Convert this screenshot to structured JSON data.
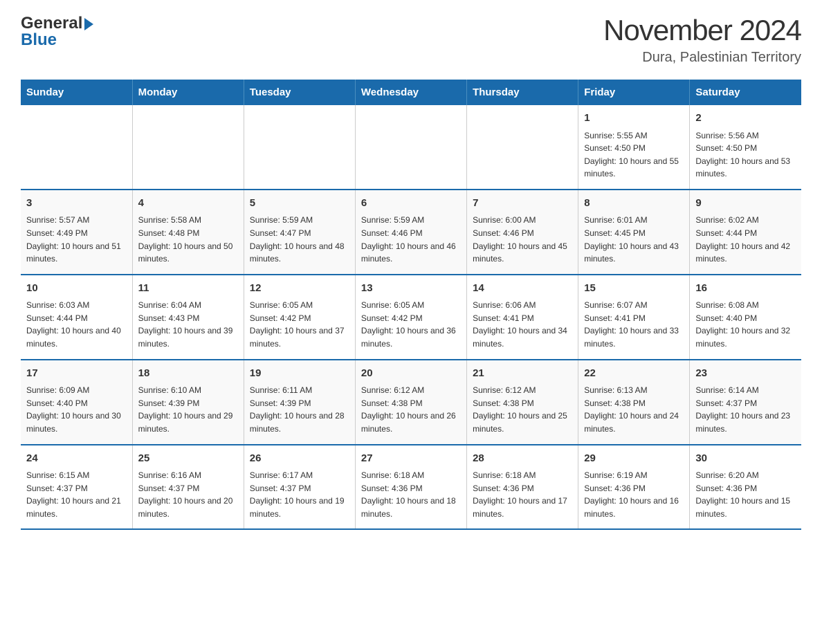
{
  "logo": {
    "general": "General",
    "blue": "Blue",
    "arrow": "▶"
  },
  "title": "November 2024",
  "subtitle": "Dura, Palestinian Territory",
  "days_of_week": [
    "Sunday",
    "Monday",
    "Tuesday",
    "Wednesday",
    "Thursday",
    "Friday",
    "Saturday"
  ],
  "weeks": [
    [
      {
        "day": "",
        "info": ""
      },
      {
        "day": "",
        "info": ""
      },
      {
        "day": "",
        "info": ""
      },
      {
        "day": "",
        "info": ""
      },
      {
        "day": "",
        "info": ""
      },
      {
        "day": "1",
        "info": "Sunrise: 5:55 AM\nSunset: 4:50 PM\nDaylight: 10 hours and 55 minutes."
      },
      {
        "day": "2",
        "info": "Sunrise: 5:56 AM\nSunset: 4:50 PM\nDaylight: 10 hours and 53 minutes."
      }
    ],
    [
      {
        "day": "3",
        "info": "Sunrise: 5:57 AM\nSunset: 4:49 PM\nDaylight: 10 hours and 51 minutes."
      },
      {
        "day": "4",
        "info": "Sunrise: 5:58 AM\nSunset: 4:48 PM\nDaylight: 10 hours and 50 minutes."
      },
      {
        "day": "5",
        "info": "Sunrise: 5:59 AM\nSunset: 4:47 PM\nDaylight: 10 hours and 48 minutes."
      },
      {
        "day": "6",
        "info": "Sunrise: 5:59 AM\nSunset: 4:46 PM\nDaylight: 10 hours and 46 minutes."
      },
      {
        "day": "7",
        "info": "Sunrise: 6:00 AM\nSunset: 4:46 PM\nDaylight: 10 hours and 45 minutes."
      },
      {
        "day": "8",
        "info": "Sunrise: 6:01 AM\nSunset: 4:45 PM\nDaylight: 10 hours and 43 minutes."
      },
      {
        "day": "9",
        "info": "Sunrise: 6:02 AM\nSunset: 4:44 PM\nDaylight: 10 hours and 42 minutes."
      }
    ],
    [
      {
        "day": "10",
        "info": "Sunrise: 6:03 AM\nSunset: 4:44 PM\nDaylight: 10 hours and 40 minutes."
      },
      {
        "day": "11",
        "info": "Sunrise: 6:04 AM\nSunset: 4:43 PM\nDaylight: 10 hours and 39 minutes."
      },
      {
        "day": "12",
        "info": "Sunrise: 6:05 AM\nSunset: 4:42 PM\nDaylight: 10 hours and 37 minutes."
      },
      {
        "day": "13",
        "info": "Sunrise: 6:05 AM\nSunset: 4:42 PM\nDaylight: 10 hours and 36 minutes."
      },
      {
        "day": "14",
        "info": "Sunrise: 6:06 AM\nSunset: 4:41 PM\nDaylight: 10 hours and 34 minutes."
      },
      {
        "day": "15",
        "info": "Sunrise: 6:07 AM\nSunset: 4:41 PM\nDaylight: 10 hours and 33 minutes."
      },
      {
        "day": "16",
        "info": "Sunrise: 6:08 AM\nSunset: 4:40 PM\nDaylight: 10 hours and 32 minutes."
      }
    ],
    [
      {
        "day": "17",
        "info": "Sunrise: 6:09 AM\nSunset: 4:40 PM\nDaylight: 10 hours and 30 minutes."
      },
      {
        "day": "18",
        "info": "Sunrise: 6:10 AM\nSunset: 4:39 PM\nDaylight: 10 hours and 29 minutes."
      },
      {
        "day": "19",
        "info": "Sunrise: 6:11 AM\nSunset: 4:39 PM\nDaylight: 10 hours and 28 minutes."
      },
      {
        "day": "20",
        "info": "Sunrise: 6:12 AM\nSunset: 4:38 PM\nDaylight: 10 hours and 26 minutes."
      },
      {
        "day": "21",
        "info": "Sunrise: 6:12 AM\nSunset: 4:38 PM\nDaylight: 10 hours and 25 minutes."
      },
      {
        "day": "22",
        "info": "Sunrise: 6:13 AM\nSunset: 4:38 PM\nDaylight: 10 hours and 24 minutes."
      },
      {
        "day": "23",
        "info": "Sunrise: 6:14 AM\nSunset: 4:37 PM\nDaylight: 10 hours and 23 minutes."
      }
    ],
    [
      {
        "day": "24",
        "info": "Sunrise: 6:15 AM\nSunset: 4:37 PM\nDaylight: 10 hours and 21 minutes."
      },
      {
        "day": "25",
        "info": "Sunrise: 6:16 AM\nSunset: 4:37 PM\nDaylight: 10 hours and 20 minutes."
      },
      {
        "day": "26",
        "info": "Sunrise: 6:17 AM\nSunset: 4:37 PM\nDaylight: 10 hours and 19 minutes."
      },
      {
        "day": "27",
        "info": "Sunrise: 6:18 AM\nSunset: 4:36 PM\nDaylight: 10 hours and 18 minutes."
      },
      {
        "day": "28",
        "info": "Sunrise: 6:18 AM\nSunset: 4:36 PM\nDaylight: 10 hours and 17 minutes."
      },
      {
        "day": "29",
        "info": "Sunrise: 6:19 AM\nSunset: 4:36 PM\nDaylight: 10 hours and 16 minutes."
      },
      {
        "day": "30",
        "info": "Sunrise: 6:20 AM\nSunset: 4:36 PM\nDaylight: 10 hours and 15 minutes."
      }
    ]
  ]
}
